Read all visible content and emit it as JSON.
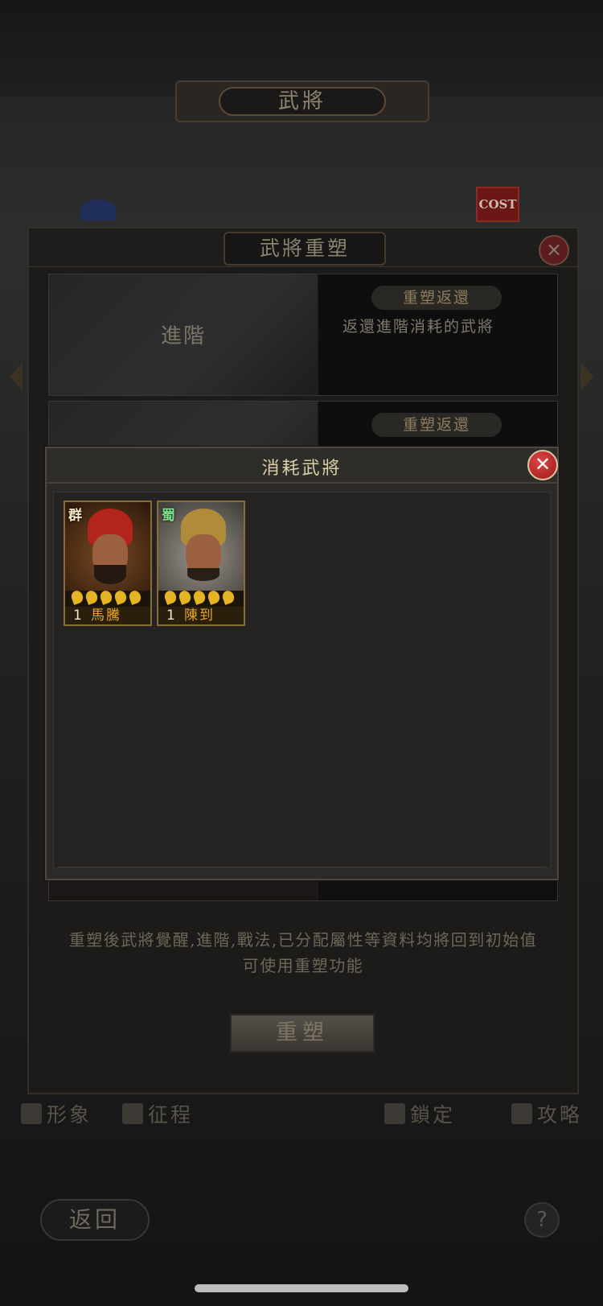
{
  "screen": {
    "title": "武將"
  },
  "badges": {
    "cost": "COST"
  },
  "main_dialog": {
    "title": "武將重塑",
    "close_icon": "close-icon",
    "rows": [
      {
        "left_label": "進階",
        "tag": "重塑返還",
        "description": "返還進階消耗的武將"
      },
      {
        "left_label": "",
        "tag": "重塑返還",
        "description": ""
      }
    ],
    "notes": [
      "重塑後武將覺醒,進階,戰法,已分配屬性等資料均將回到初始值",
      "可使用重塑功能"
    ],
    "reshape_button": "重塑"
  },
  "bottom_nav": [
    {
      "label": "形象",
      "icon": "person-icon"
    },
    {
      "label": "征程",
      "icon": "flag-icon"
    },
    {
      "label": "鎖定",
      "icon": "lock-icon"
    },
    {
      "label": "攻略",
      "icon": "scroll-icon"
    }
  ],
  "back_button": "返回",
  "help_button": "?",
  "modal": {
    "title": "消耗武將",
    "close_icon": "close-icon",
    "generals": [
      {
        "faction": "群",
        "faction_color": "#f2e6c8",
        "level": "1",
        "name": "馬騰",
        "stars": 5,
        "helmet_color": "#b3241c",
        "bg_color": "#5a3a1c"
      },
      {
        "faction": "蜀",
        "faction_color": "#7ee08a",
        "level": "1",
        "name": "陳到",
        "stars": 5,
        "helmet_color": "#b08b3a",
        "bg_color": "#8c8a86"
      }
    ]
  }
}
